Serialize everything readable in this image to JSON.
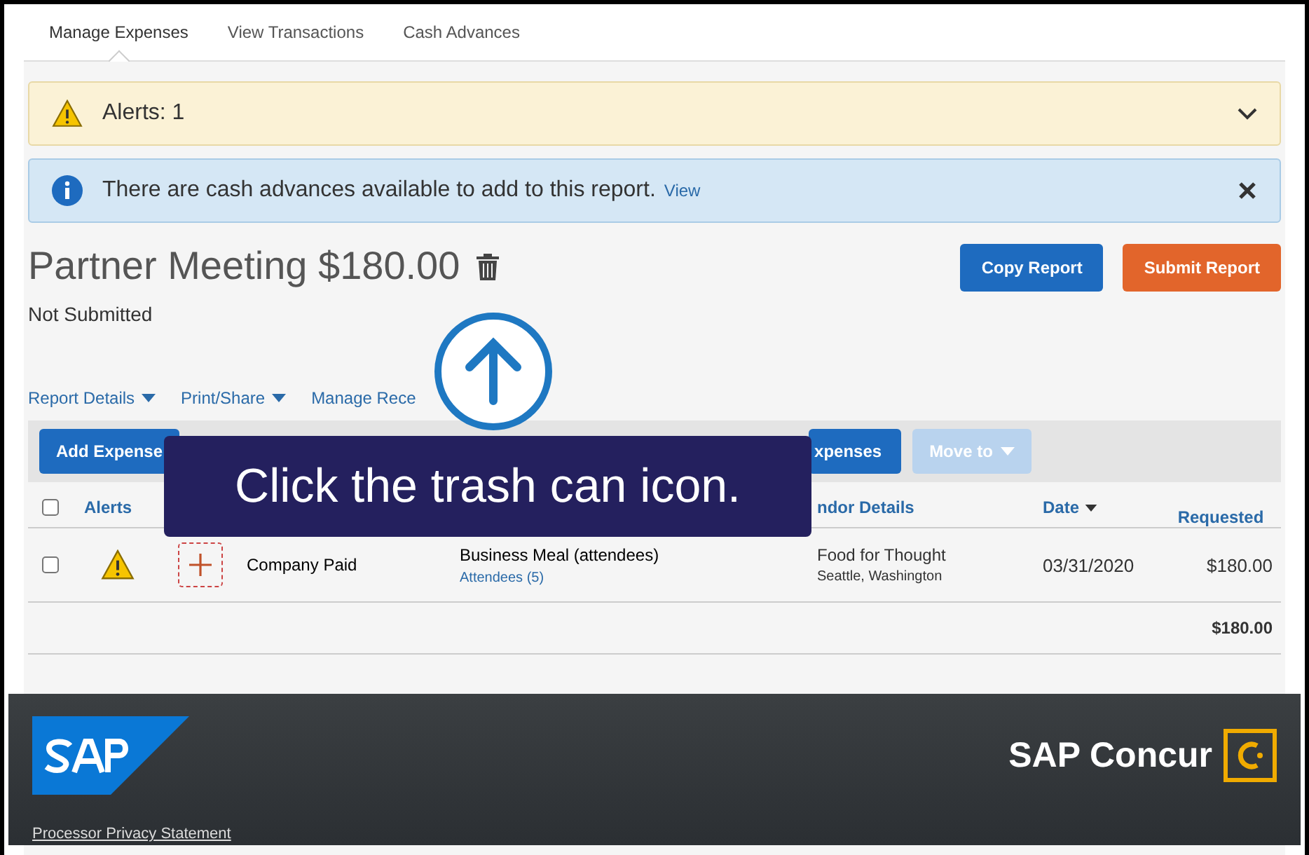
{
  "tabs": [
    {
      "label": "Manage Expenses",
      "selected": true
    },
    {
      "label": "View Transactions",
      "selected": false
    },
    {
      "label": "Cash Advances",
      "selected": false
    }
  ],
  "alert_bar": {
    "label": "Alerts: 1",
    "expanded": false
  },
  "notice": {
    "text": "There are cash advances available to add to this report.",
    "link": "View"
  },
  "report": {
    "title": "Partner Meeting $180.00",
    "status": "Not Submitted"
  },
  "report_buttons": [
    {
      "label": "Copy Report",
      "kind": "primary"
    },
    {
      "label": "Submit Report",
      "kind": "submit"
    }
  ],
  "report_menus": [
    {
      "label": "Report Details",
      "dropdown": true
    },
    {
      "label": "Print/Share",
      "dropdown": true
    },
    {
      "label": "Manage Rece",
      "dropdown": false
    }
  ],
  "toolbar": [
    {
      "label": "Add Expense",
      "disabled": false
    },
    {
      "label": "xpenses",
      "disabled": false
    },
    {
      "label": "Move to",
      "disabled": true
    }
  ],
  "table": {
    "all_checked": false,
    "columns": [
      "Alerts",
      "ndor Details",
      "Date",
      "Requested"
    ],
    "rows": [
      {
        "checked": false,
        "payment": "Company Paid",
        "expense_type": "Business Meal (attendees)",
        "attendees": "Attendees (5)",
        "vendor": "Food for Thought",
        "location": "Seattle, Washington",
        "date": "03/31/2020",
        "amount": "$180.00"
      }
    ],
    "total": "$180.00"
  },
  "callout": "Click the trash can icon.",
  "footer": {
    "brand": "SAP Concur",
    "link": "Processor Privacy Statement"
  }
}
